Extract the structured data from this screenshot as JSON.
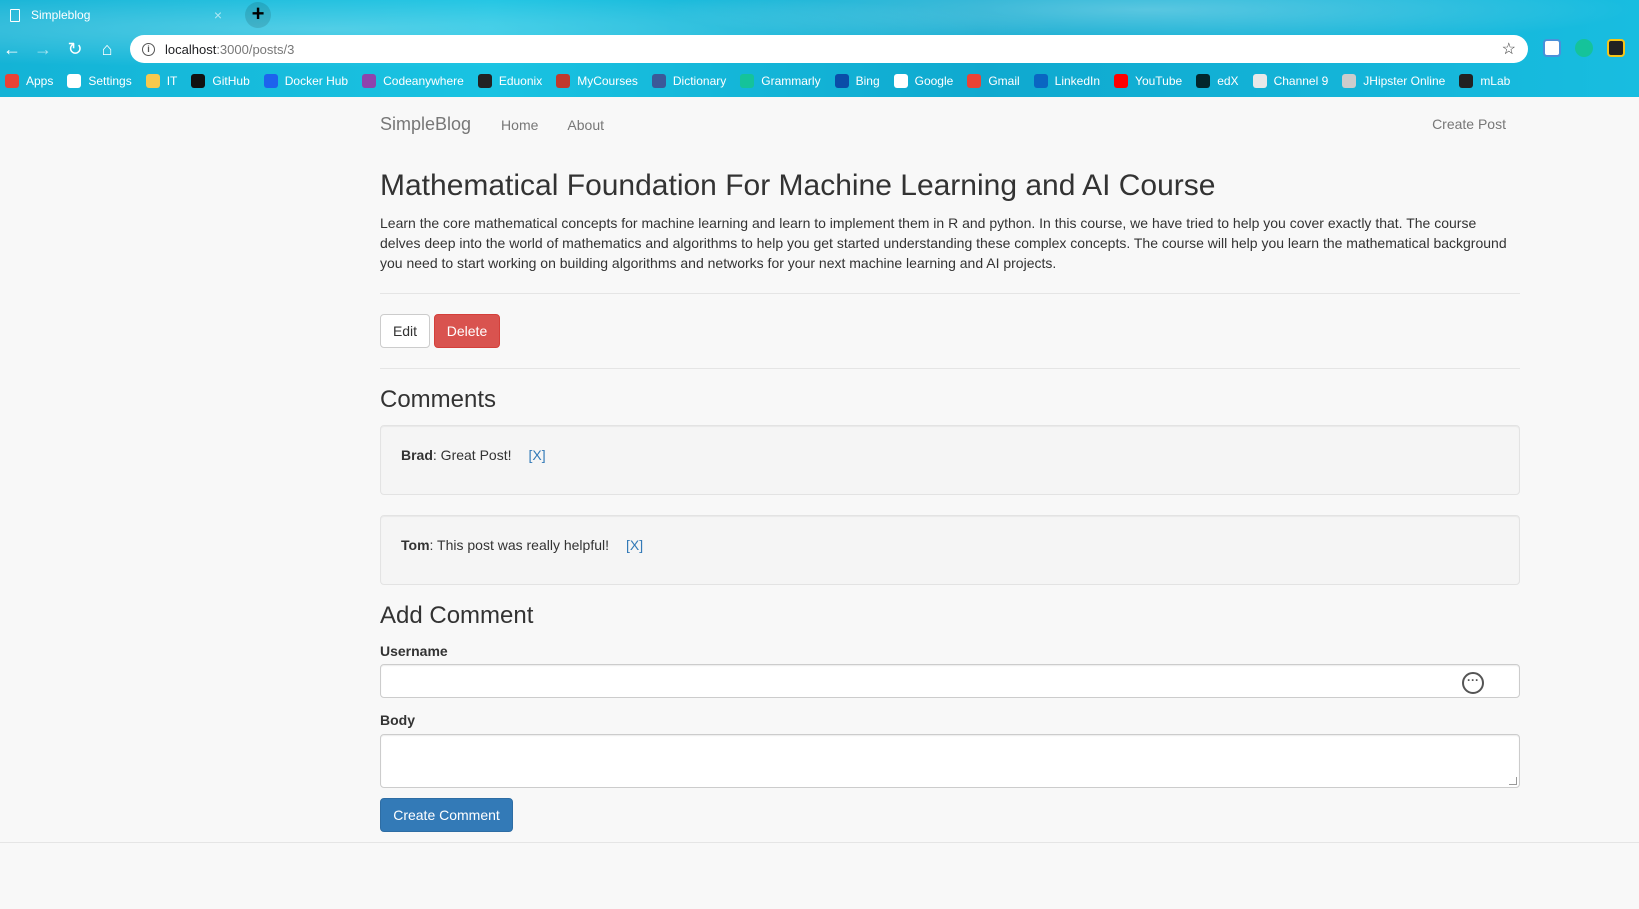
{
  "browser": {
    "tab_title": "Simpleblog",
    "tab_close": "×",
    "new_tab": "+",
    "url_host": "localhost",
    "url_path": ":3000/posts/3",
    "bookmarks": [
      {
        "label": "Apps",
        "icon": "apps-grid-icon",
        "color": "#e94235"
      },
      {
        "label": "Settings",
        "icon": "gear-icon",
        "color": "#ffffff"
      },
      {
        "label": "IT",
        "icon": "folder-icon",
        "color": "#f6c94e"
      },
      {
        "label": "GitHub",
        "icon": "github-icon",
        "color": "#111111"
      },
      {
        "label": "Docker Hub",
        "icon": "docker-icon",
        "color": "#1d63ed"
      },
      {
        "label": "Codeanywhere",
        "icon": "codeanywhere-icon",
        "color": "#8e44ad"
      },
      {
        "label": "Eduonix",
        "icon": "eduonix-icon",
        "color": "#222222"
      },
      {
        "label": "MyCourses",
        "icon": "mycourses-icon",
        "color": "#c0392b"
      },
      {
        "label": "Dictionary",
        "icon": "dictionary-icon",
        "color": "#3b5998"
      },
      {
        "label": "Grammarly",
        "icon": "grammarly-icon",
        "color": "#15c39a"
      },
      {
        "label": "Bing",
        "icon": "bing-icon",
        "color": "#0a4da8"
      },
      {
        "label": "Google",
        "icon": "google-icon",
        "color": "#ffffff"
      },
      {
        "label": "Gmail",
        "icon": "gmail-icon",
        "color": "#ea4335"
      },
      {
        "label": "LinkedIn",
        "icon": "linkedin-icon",
        "color": "#0a66c2"
      },
      {
        "label": "YouTube",
        "icon": "youtube-icon",
        "color": "#ff0000"
      },
      {
        "label": "edX",
        "icon": "edx-icon",
        "color": "#02262b"
      },
      {
        "label": "Channel 9",
        "icon": "channel9-icon",
        "color": "#e8e8e8"
      },
      {
        "label": "JHipster Online",
        "icon": "jhipster-icon",
        "color": "#cccccc"
      },
      {
        "label": "mLab",
        "icon": "mlab-icon",
        "color": "#222222"
      }
    ]
  },
  "navbar": {
    "brand": "SimpleBlog",
    "home": "Home",
    "about": "About",
    "create_post": "Create Post"
  },
  "post": {
    "title": "Mathematical Foundation For Machine Learning and AI Course",
    "body": "Learn the core mathematical concepts for machine learning and learn to implement them in R and python. In this course, we have tried to help you cover exactly that. The course delves deep into the world of mathematics and algorithms to help you get started understanding these complex concepts. The course will help you learn the mathematical background you need to start working on building algorithms and networks for your next machine learning and AI projects.",
    "edit_label": "Edit",
    "delete_label": "Delete"
  },
  "comments": {
    "title": "Comments",
    "items": [
      {
        "user": "Brad",
        "text": ": Great Post!",
        "delete": "[X]"
      },
      {
        "user": "Tom",
        "text": ": This post was really helpful!",
        "delete": "[X]"
      }
    ]
  },
  "add_comment": {
    "title": "Add Comment",
    "username_label": "Username",
    "username_value": "",
    "body_label": "Body",
    "body_value": "",
    "submit_label": "Create Comment"
  },
  "colors": {
    "danger": "#d9534f",
    "primary": "#337ab7",
    "chrome": "#19c3e2"
  }
}
